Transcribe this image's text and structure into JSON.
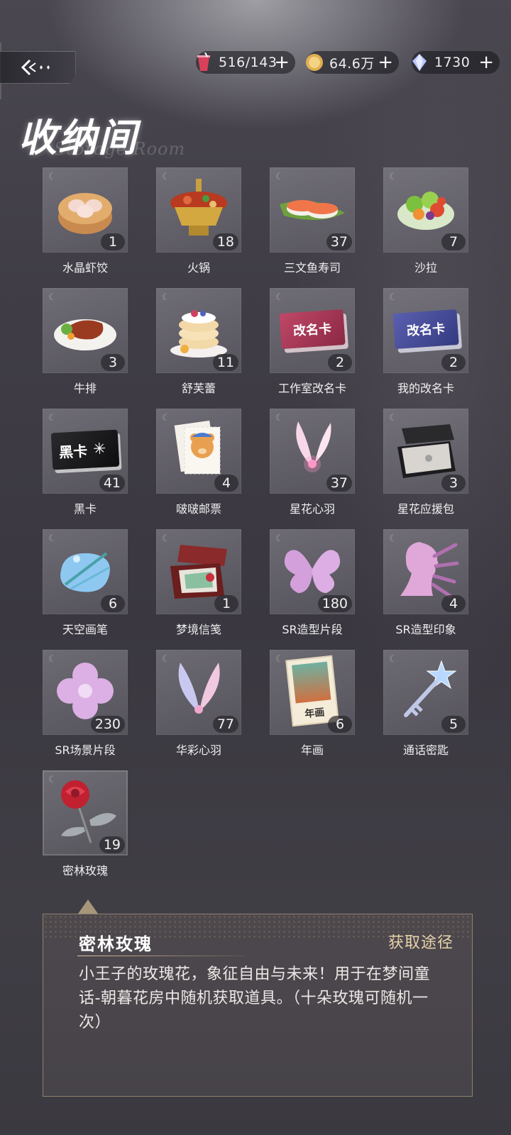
{
  "header": {
    "title": "收纳间",
    "subtitle": "Storage Room",
    "currencies": [
      {
        "icon": "drink-cup-icon",
        "value": "516/143",
        "plus": "+",
        "color": "#e04860"
      },
      {
        "icon": "gold-coin-icon",
        "value": "64.6万",
        "plus": "+",
        "color": "#e0b050"
      },
      {
        "icon": "diamond-icon",
        "value": "1730",
        "plus": "+",
        "color": "#b8c4ff"
      }
    ]
  },
  "items": [
    {
      "name": "水晶虾饺",
      "count": "1",
      "icon": "dumpling-steamer-icon"
    },
    {
      "name": "火锅",
      "count": "18",
      "icon": "hotpot-icon"
    },
    {
      "name": "三文鱼寿司",
      "count": "37",
      "icon": "salmon-sushi-icon"
    },
    {
      "name": "沙拉",
      "count": "7",
      "icon": "salad-icon"
    },
    {
      "name": "牛排",
      "count": "3",
      "icon": "steak-icon"
    },
    {
      "name": "舒芙蕾",
      "count": "11",
      "icon": "souffle-icon"
    },
    {
      "name": "工作室改名卡",
      "count": "2",
      "icon": "rename-card-red-icon",
      "card_text": "改名卡"
    },
    {
      "name": "我的改名卡",
      "count": "2",
      "icon": "rename-card-blue-icon",
      "card_text": "改名卡"
    },
    {
      "name": "黑卡",
      "count": "41",
      "icon": "black-card-icon",
      "card_text": "黑卡"
    },
    {
      "name": "啵啵邮票",
      "count": "4",
      "icon": "bear-stamp-icon"
    },
    {
      "name": "星花心羽",
      "count": "37",
      "icon": "pink-feather-icon"
    },
    {
      "name": "星花应援包",
      "count": "3",
      "icon": "gift-box-icon"
    },
    {
      "name": "天空画笔",
      "count": "6",
      "icon": "paint-palette-icon"
    },
    {
      "name": "梦境信笺",
      "count": "1",
      "icon": "letter-box-icon"
    },
    {
      "name": "SR造型片段",
      "count": "180",
      "icon": "butterfly-fragment-icon"
    },
    {
      "name": "SR造型印象",
      "count": "4",
      "icon": "silhouette-impression-icon"
    },
    {
      "name": "SR场景片段",
      "count": "230",
      "icon": "clover-fragment-icon"
    },
    {
      "name": "华彩心羽",
      "count": "77",
      "icon": "rainbow-feather-icon"
    },
    {
      "name": "年画",
      "count": "6",
      "icon": "new-year-painting-icon",
      "card_text": "年画"
    },
    {
      "name": "通话密匙",
      "count": "5",
      "icon": "star-key-icon"
    },
    {
      "name": "密林玫瑰",
      "count": "19",
      "icon": "red-rose-icon"
    }
  ],
  "detail": {
    "name": "密林玫瑰",
    "link": "获取途径",
    "description": "小王子的玫瑰花，象征自由与未来！用于在梦间童话-朝暮花房中随机获取道具。（十朵玫瑰可随机一次）"
  },
  "colors": {
    "accent_gold": "#e7d3aa",
    "background": "#403d46"
  }
}
